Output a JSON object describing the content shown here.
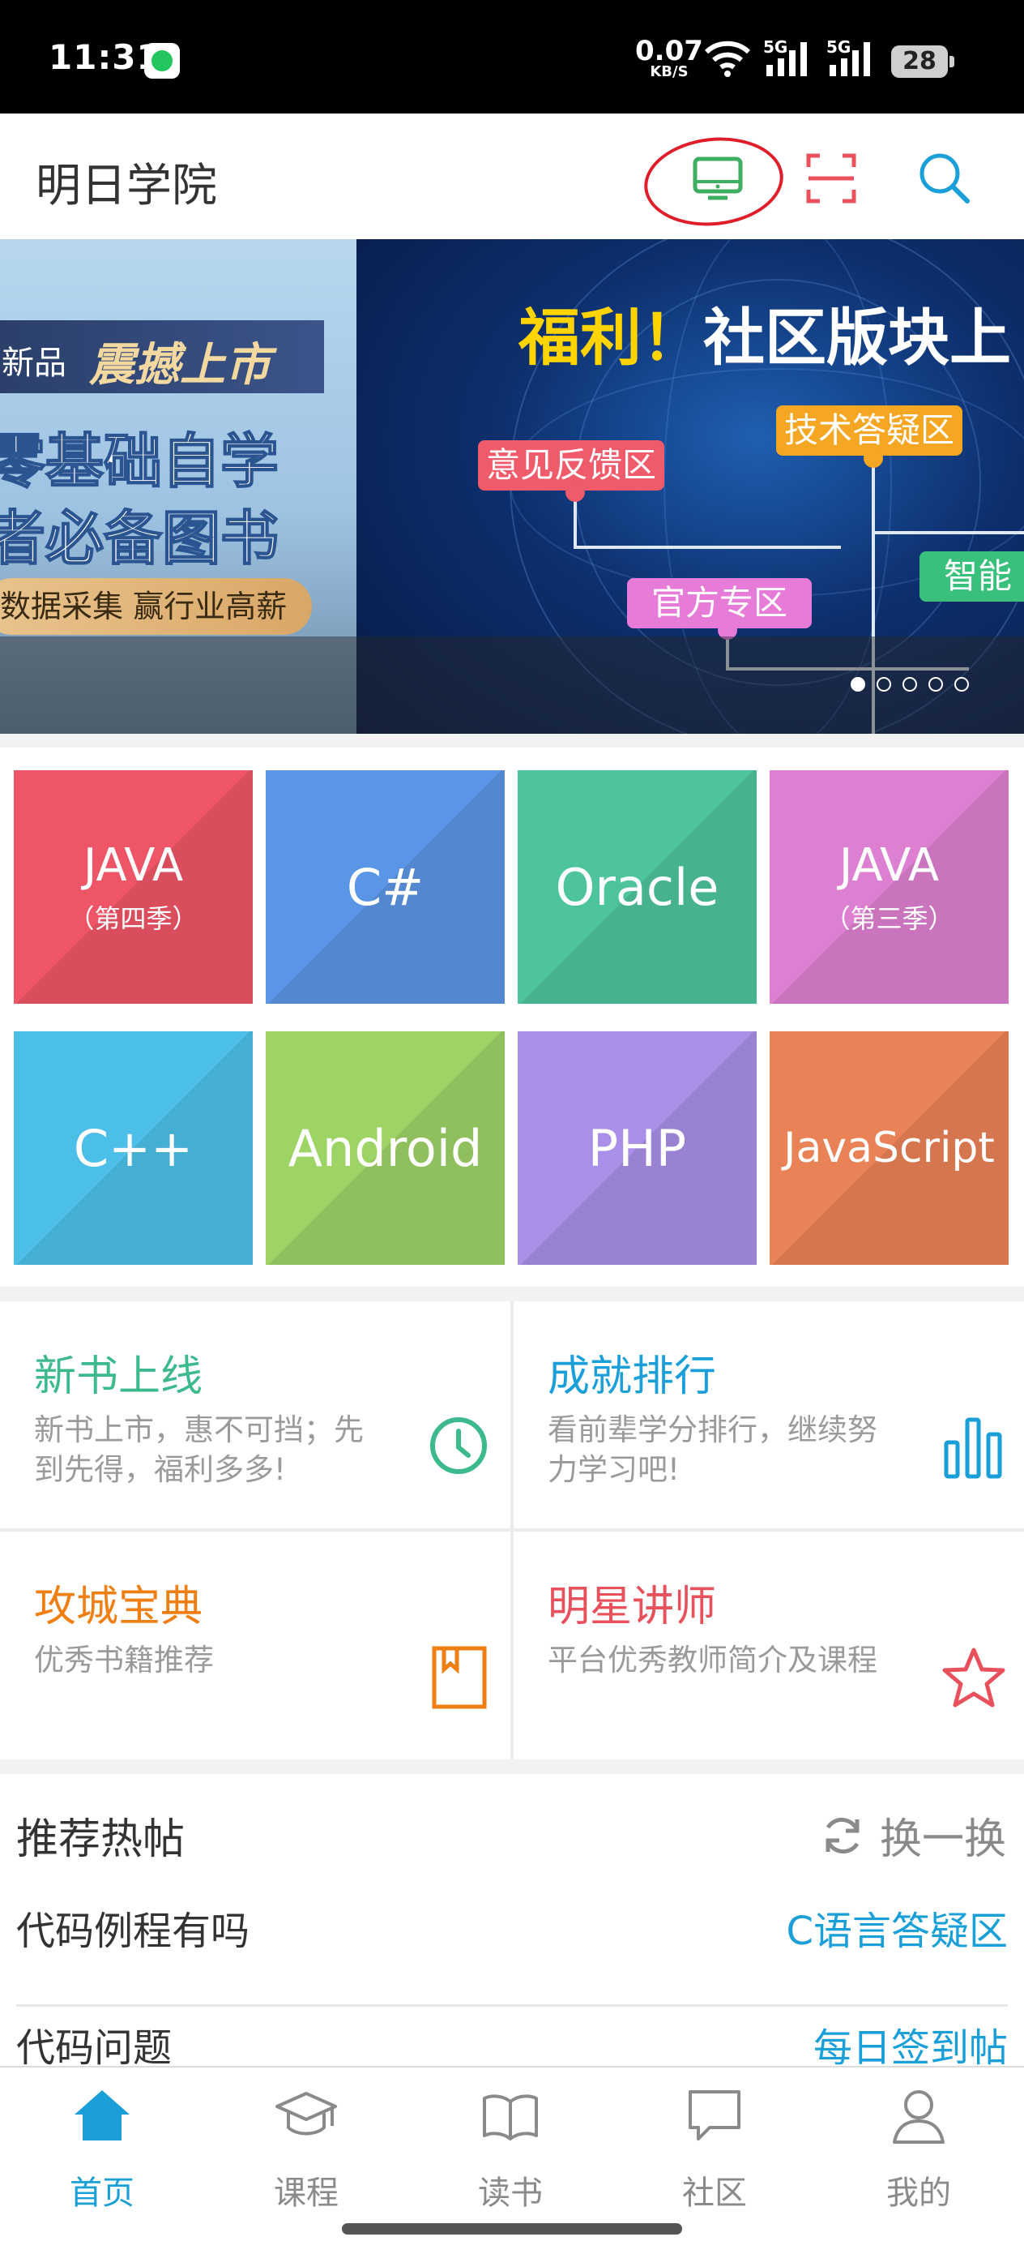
{
  "status_bar": {
    "time": "11:31",
    "net_speed_value": "0.07",
    "net_speed_unit": "KB/S",
    "network_1": "5G",
    "network_2": "5G",
    "battery": "28"
  },
  "header": {
    "title": "明日学院",
    "icons": [
      "monitor-icon",
      "scan-icon",
      "search-icon"
    ],
    "accent_color": "#1a9fd8"
  },
  "banner": {
    "left": {
      "tag": "新品",
      "tag_title": "震撼上市",
      "line1": "零基础自学",
      "line2": "者必备图书",
      "pill": "数据采集 赢行业高薪"
    },
    "right": {
      "title_emph": "福利！",
      "title_rest": "社区版块上",
      "tags": [
        "意见反馈区",
        "技术答疑区",
        "官方专区",
        "智能"
      ]
    },
    "slide_count": 5,
    "active_slide": 1
  },
  "courses": [
    {
      "line1": "JAVA",
      "line2": "（第四季）",
      "color": "#ee5566"
    },
    {
      "line1": "C#",
      "line2": "",
      "color": "#5b96e6"
    },
    {
      "line1": "Oracle",
      "line2": "",
      "color": "#4dc49d"
    },
    {
      "line1": "JAVA",
      "line2": "（第三季）",
      "color": "#de80d1"
    },
    {
      "line1": "C++",
      "line2": "",
      "color": "#4cbfe8"
    },
    {
      "line1": "Android",
      "line2": "",
      "color": "#9ed366"
    },
    {
      "line1": "PHP",
      "line2": "",
      "color": "#a98fe8"
    },
    {
      "line1": "JavaScript",
      "line2": "",
      "color": "#ea8257"
    }
  ],
  "features": [
    {
      "title": "新书上线",
      "desc": "新书上市，惠不可挡；先到先得，福利多多!",
      "color": "#3dba8c",
      "icon": "clock-icon"
    },
    {
      "title": "成就排行",
      "desc": "看前辈学分排行，继续努力学习吧!",
      "color": "#1a9fd8",
      "icon": "bar-chart-icon"
    },
    {
      "title": "攻城宝典",
      "desc": "优秀书籍推荐",
      "color": "#ef7e13",
      "icon": "book-icon"
    },
    {
      "title": "明星讲师",
      "desc": "平台优秀教师简介及课程",
      "color": "#e8505b",
      "icon": "star-icon"
    }
  ],
  "hot_posts": {
    "title": "推荐热帖",
    "refresh_label": "换一换",
    "items": [
      {
        "title": "代码例程有吗",
        "category": "C语言答疑区"
      },
      {
        "title": "代码问题",
        "category": "每日签到帖"
      }
    ]
  },
  "bottom_nav": [
    {
      "label": "首页",
      "icon": "home-icon",
      "active": true
    },
    {
      "label": "课程",
      "icon": "graduation-cap-icon",
      "active": false
    },
    {
      "label": "读书",
      "icon": "open-book-icon",
      "active": false
    },
    {
      "label": "社区",
      "icon": "chat-bubble-icon",
      "active": false
    },
    {
      "label": "我的",
      "icon": "user-icon",
      "active": false
    }
  ]
}
